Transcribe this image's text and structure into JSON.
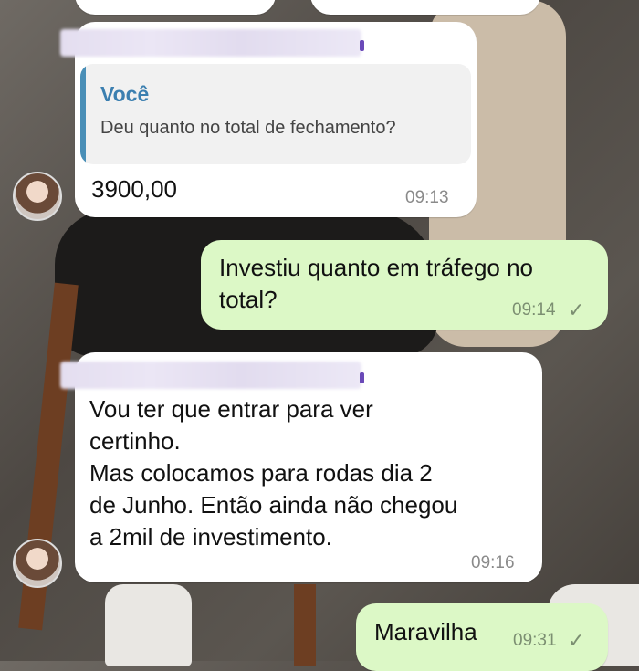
{
  "chat": {
    "messages": [
      {
        "id": "m1",
        "direction": "incoming",
        "quoted": {
          "author": "Você",
          "text": "Deu quanto no total de fechamento?"
        },
        "text": "3900,00",
        "time": "09:13"
      },
      {
        "id": "m2",
        "direction": "outgoing",
        "text": "Investiu quanto em tráfego no\ntotal?",
        "time": "09:14",
        "status": "sent"
      },
      {
        "id": "m3",
        "direction": "incoming",
        "text": "Vou ter que entrar para ver\ncertinho.\nMas colocamos para rodas dia 2\nde Junho. Então ainda não chegou\na 2mil de investimento.",
        "time": "09:16"
      },
      {
        "id": "m4",
        "direction": "outgoing",
        "text": "Maravilha",
        "time": "09:31",
        "status": "sent"
      }
    ],
    "status_icon": "single-check-icon",
    "colors": {
      "incoming_bubble": "#ffffff",
      "outgoing_bubble": "#dcf8c6",
      "quote_author": "#3b7fb0",
      "quote_bar": "#4a8fb7",
      "sender_name_tail": "#6a49b8"
    }
  }
}
